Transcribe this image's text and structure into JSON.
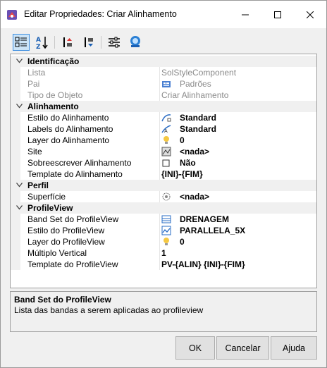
{
  "window": {
    "title": "Editar Propriedades: Criar Alinhamento"
  },
  "toolbar": {
    "buttons": [
      {
        "icon": "categorized-icon",
        "active": true
      },
      {
        "icon": "sort-alphabetical-icon"
      },
      {
        "icon": "move-up-icon"
      },
      {
        "icon": "move-down-icon"
      },
      {
        "icon": "settings-sliders-icon"
      },
      {
        "icon": "help-search-icon"
      }
    ]
  },
  "categories": [
    {
      "label": "Identificação",
      "props": [
        {
          "name": "Lista",
          "value": "SolStyleComponent",
          "disabled": true
        },
        {
          "name": "Pai",
          "value": "Padrões",
          "disabled": true,
          "icon": "folder-icon"
        },
        {
          "name": "Tipo de Objeto",
          "value": "Criar Alinhamento",
          "disabled": true
        }
      ]
    },
    {
      "label": "Alinhamento",
      "props": [
        {
          "name": "Estilo do Alinhamento",
          "value": "Standard",
          "icon": "alignment-style-icon"
        },
        {
          "name": "Labels do Alinhamento",
          "value": "Standard",
          "icon": "label-style-icon"
        },
        {
          "name": "Layer do Alinhamento",
          "value": "0",
          "icon": "layer-bulb-icon"
        },
        {
          "name": "Site",
          "value": "<nada>",
          "icon": "site-icon"
        },
        {
          "name": "Sobreescrever Alinhamento",
          "value": "Não",
          "icon": "checkbox-icon"
        },
        {
          "name": "Template do Alinhamento",
          "value": "{INI}-{FIM}"
        }
      ]
    },
    {
      "label": "Perfil",
      "props": [
        {
          "name": "Superfície",
          "value": "<nada>",
          "icon": "surface-icon"
        }
      ]
    },
    {
      "label": "ProfileView",
      "props": [
        {
          "name": "Band Set do ProfileView",
          "value": "DRENAGEM",
          "icon": "band-set-icon"
        },
        {
          "name": "Estilo do ProfileView",
          "value": "PARALLELA_5X",
          "icon": "profileview-style-icon"
        },
        {
          "name": "Layer do ProfileView",
          "value": "0",
          "icon": "layer-bulb-icon"
        },
        {
          "name": "Múltiplo Vertical",
          "value": "1"
        },
        {
          "name": "Template do ProfileView",
          "value": "PV-{ALIN} {INI}-{FIM}"
        }
      ]
    }
  ],
  "help": {
    "title": "Band Set do ProfileView",
    "description": "Lista das bandas a serem aplicadas ao profileview"
  },
  "buttons": {
    "ok": "OK",
    "cancel": "Cancelar",
    "help": "Ajuda"
  },
  "colors": {
    "selection": "#cce4f7",
    "accent": "#3d8ee0",
    "category_bg": "#f0f0f0",
    "disabled_text": "#8a8a8a"
  }
}
